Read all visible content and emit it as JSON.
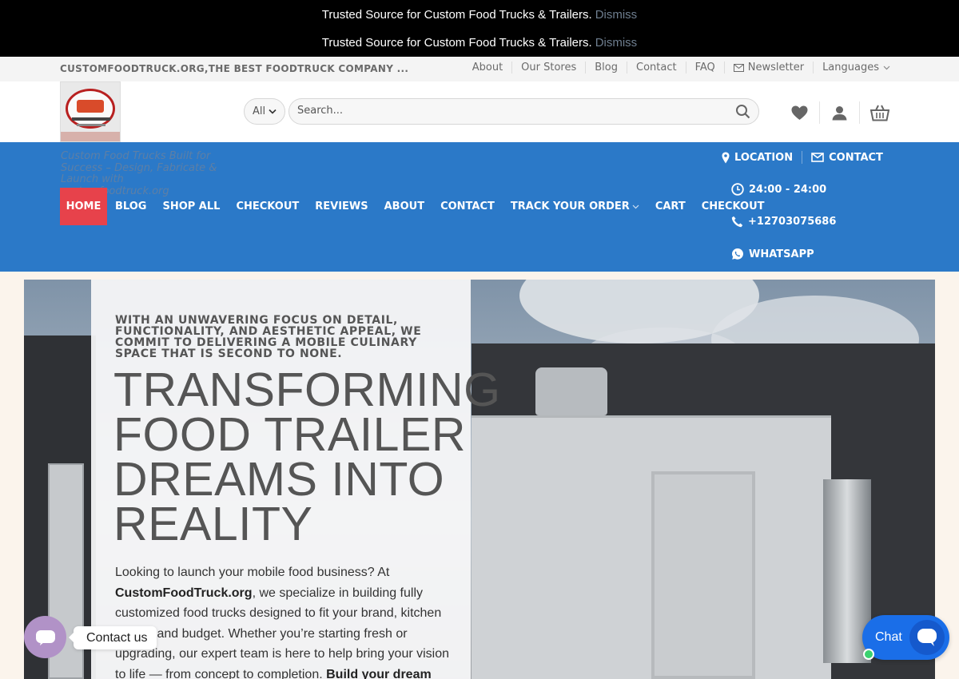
{
  "notices": [
    {
      "text": "Trusted Source for Custom Food Trucks & Trailers.",
      "dismiss": "Dismiss"
    },
    {
      "text": "Trusted Source for Custom Food Trucks & Trailers.",
      "dismiss": "Dismiss"
    }
  ],
  "topbar": {
    "brand": "CUSTOMFOODTRUCK.ORG,THE BEST FOODTRUCK COMPANY ...",
    "links": [
      "About",
      "Our Stores",
      "Blog",
      "Contact",
      "FAQ",
      "Newsletter",
      "Languages"
    ]
  },
  "header": {
    "category": "All",
    "search_placeholder": "Search..."
  },
  "nav": {
    "tagline": "Custom Food Trucks Built for Success – Design, Fabricate & Launch with customfoodtruck.org",
    "home": "HOME",
    "items": [
      "BLOG",
      "SHOP ALL",
      "CHECKOUT",
      "REVIEWS",
      "ABOUT",
      "CONTACT",
      "TRACK YOUR ORDER",
      "CART",
      "CHECKOUT"
    ],
    "right": {
      "location": "LOCATION",
      "contact": "CONTACT",
      "hours": "24:00 - 24:00",
      "phone": "+12703075686",
      "whatsapp": "WHATSAPP"
    }
  },
  "hero": {
    "kicker": "WITH AN UNWAVERING FOCUS ON DETAIL, FUNCTIONALITY, AND AESTHETIC APPEAL, WE COMMIT TO DELIVERING A MOBILE CULINARY SPACE THAT IS SECOND TO NONE.",
    "title_lines": [
      "TRANSFORMING",
      "FOOD TRAILER",
      "DREAMS INTO",
      "REALITY"
    ],
    "body_intro": "Looking to launch your mobile food business? At",
    "body_brand": "CustomFoodTruck.org",
    "body_main": ", we specialize in building fully customized food trucks designed to fit your brand, kitchen needs, and budget. Whether you’re starting fresh or upgrading, our expert team is here to help bring your vision to life — from concept to completion.",
    "body_cta": "Build your dream"
  },
  "widgets": {
    "contact_label": "Contact us",
    "chat_label": "Chat"
  },
  "colors": {
    "nav_blue": "#2b79c8",
    "home_red": "#e7424b",
    "chat_blue": "#1a6ee8",
    "contact_purple": "#b192c7"
  }
}
